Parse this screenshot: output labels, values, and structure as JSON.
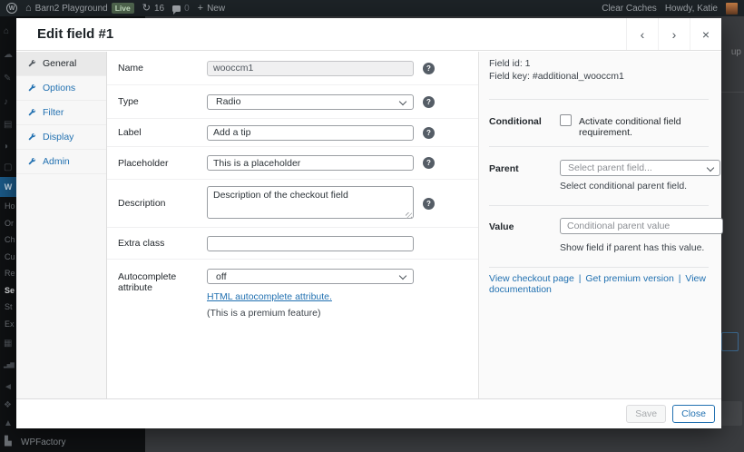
{
  "icons": {
    "wp": "W",
    "home": "⌂",
    "update": "↻",
    "plus": "+",
    "chevron_left": "‹",
    "chevron_right": "›",
    "close": "×",
    "help": "?",
    "house": "⌂",
    "cloud": "☁",
    "pin": "✎",
    "media": "♪",
    "pages": "▤",
    "comments": "◗",
    "feedback": "▢",
    "woocommerce": "W",
    "products": "▦",
    "analytics": "▂▅▇",
    "marketing": "◄",
    "plugins": "❖",
    "tools": "▲",
    "factory": "▙"
  },
  "admin_bar": {
    "site_name": "Barn2 Playground",
    "live_badge": "Live",
    "update_count": "16",
    "comment_count": "0",
    "new_label": "New",
    "clear_caches": "Clear Caches",
    "howdy": "Howdy, Katie"
  },
  "sidebar": {
    "partial_items": [
      "Ho",
      "Or",
      "Ch",
      "Cu",
      "Re",
      "Se",
      "St",
      "Ex"
    ],
    "wpfactory_label": "WPFactory"
  },
  "backdrop": {
    "setup_partial": "up"
  },
  "modal": {
    "title": "Edit field #1",
    "tabs": [
      {
        "label": "General",
        "active": true
      },
      {
        "label": "Options",
        "active": false
      },
      {
        "label": "Filter",
        "active": false
      },
      {
        "label": "Display",
        "active": false
      },
      {
        "label": "Admin",
        "active": false
      }
    ],
    "form": {
      "name": {
        "label": "Name",
        "value": "wooccm1"
      },
      "type": {
        "label": "Type",
        "value": "Radio"
      },
      "field_label": {
        "label": "Label",
        "value": "Add a tip"
      },
      "placeholder": {
        "label": "Placeholder",
        "value": "This is a placeholder"
      },
      "description": {
        "label": "Description",
        "value": "Description of the checkout field"
      },
      "extra_class": {
        "label": "Extra class",
        "value": ""
      },
      "autocomplete": {
        "label": "Autocomplete attribute",
        "value": "off",
        "link": "HTML autocomplete attribute.",
        "note": "(This is a premium feature)"
      }
    },
    "side": {
      "field_id": "Field id: 1",
      "field_key": "Field key: #additional_wooccm1",
      "conditional_label": "Conditional",
      "conditional_checkbox_label": "Activate conditional field requirement.",
      "parent_label": "Parent",
      "parent_placeholder": "Select parent field...",
      "parent_helper": "Select conditional parent field.",
      "value_label": "Value",
      "value_placeholder": "Conditional parent value",
      "value_helper": "Show field if parent has this value.",
      "links": [
        "View checkout page",
        "Get premium version",
        "View documentation"
      ],
      "link_separator": "|"
    },
    "footer": {
      "save_label": "Save",
      "close_label": "Close"
    }
  },
  "colors": {
    "accent_blue": "#2271b1",
    "admin_bar_bg": "#1d2327",
    "live_badge_bg": "#50664f"
  }
}
